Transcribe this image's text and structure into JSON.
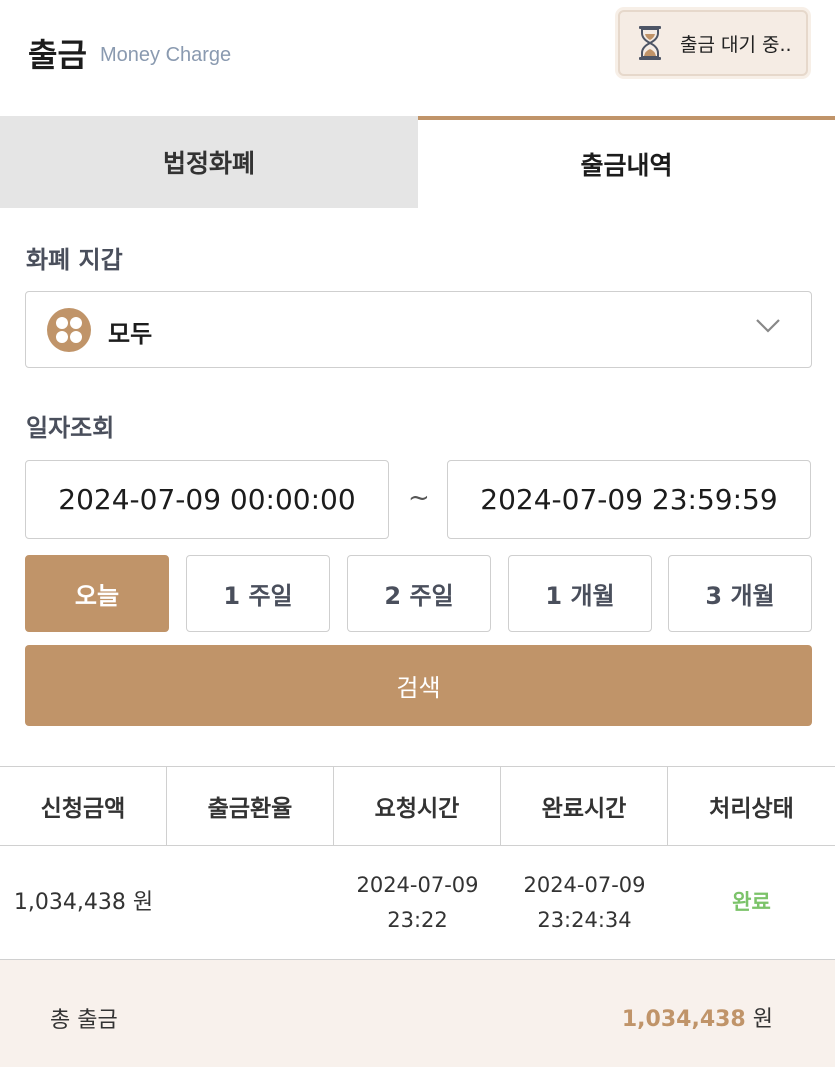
{
  "header": {
    "title": "출금",
    "subtitle": "Money Charge",
    "pending_button_label": "출금 대기 중.."
  },
  "tabs": [
    {
      "label": "법정화폐",
      "active": false
    },
    {
      "label": "출금내역",
      "active": true
    }
  ],
  "wallet": {
    "section_label": "화폐 지갑",
    "selected": "모두",
    "icon": "coins-icon"
  },
  "date_filter": {
    "section_label": "일자조회",
    "start": "2024-07-09 00:00:00",
    "separator": "~",
    "end": "2024-07-09 23:59:59"
  },
  "periods": [
    {
      "label": "오늘",
      "active": true
    },
    {
      "label": "1 주일",
      "active": false
    },
    {
      "label": "2 주일",
      "active": false
    },
    {
      "label": "1 개월",
      "active": false
    },
    {
      "label": "3 개월",
      "active": false
    }
  ],
  "search_label": "검색",
  "table": {
    "headers": [
      "신청금액",
      "출금환율",
      "요청시간",
      "완료시간",
      "처리상태"
    ],
    "rows": [
      {
        "amount": "1,034,438 원",
        "rate": "",
        "request_date": "2024-07-09",
        "request_time": "23:22",
        "complete_date": "2024-07-09",
        "complete_time": "23:24:34",
        "status": "완료"
      }
    ]
  },
  "total": {
    "label": "총 출금",
    "value": "1,034,438",
    "unit": "원"
  },
  "colors": {
    "accent": "#c09469",
    "status_complete": "#7cc36a",
    "subtitle": "#8a9ab0"
  }
}
